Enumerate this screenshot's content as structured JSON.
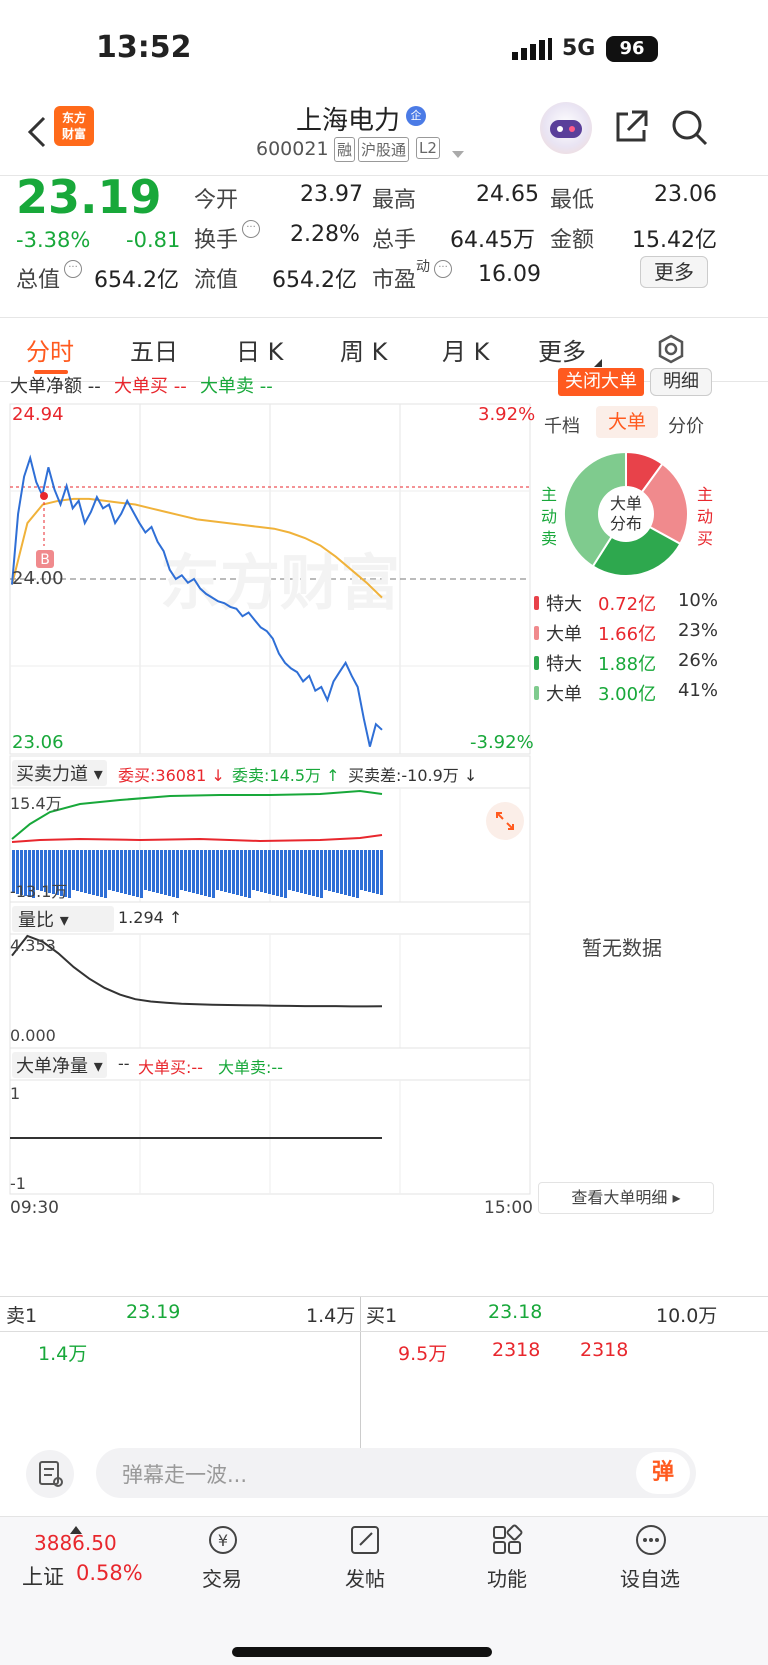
{
  "status": {
    "time": "13:52",
    "network": "5G",
    "battery": "96"
  },
  "nav": {
    "title": "上海电力",
    "title_badge": "企",
    "code": "600021",
    "tags": [
      "融",
      "沪股通",
      "L2"
    ]
  },
  "quote": {
    "price": "23.19",
    "pct": "-3.38%",
    "chg": "-0.81",
    "fields": [
      {
        "label": "今开",
        "value": "23.97",
        "color": "green"
      },
      {
        "label": "最高",
        "value": "24.65",
        "color": "red"
      },
      {
        "label": "最低",
        "value": "23.06",
        "color": "green"
      },
      {
        "label": "换手",
        "value": "2.28%",
        "color": "dark"
      },
      {
        "label": "总手",
        "value": "64.45万",
        "color": "dark"
      },
      {
        "label": "金额",
        "value": "15.42亿",
        "color": "dark"
      },
      {
        "label": "总值",
        "value": "654.2亿",
        "color": "dark"
      },
      {
        "label": "流值",
        "value": "654.2亿",
        "color": "dark"
      },
      {
        "label": "市盈",
        "sup": "动",
        "value": "16.09",
        "color": "dark"
      }
    ],
    "more_btn": "更多"
  },
  "tabs": [
    "分时",
    "五日",
    "日 K",
    "周 K",
    "月 K",
    "更多"
  ],
  "chart_header": {
    "legend_net": "大单净额 --",
    "legend_buy": "大单买 --",
    "legend_sell": "大单卖 --",
    "close_btn": "关闭大单",
    "detail_btn": "明细"
  },
  "price_axis": {
    "top": "24.94",
    "top_pct": "3.92%",
    "mid": "24.00",
    "bottom": "23.06",
    "bottom_pct": "-3.92%",
    "watermark": "东方财富",
    "marker": "B"
  },
  "side_tabs": [
    "千档",
    "大单",
    "分价"
  ],
  "pie": {
    "center1": "大单",
    "center2": "分布",
    "left": [
      "主",
      "动",
      "卖"
    ],
    "right": [
      "主",
      "动",
      "买"
    ],
    "legend": [
      {
        "name": "特大",
        "value": "0.72亿",
        "pct": "10%",
        "color": "#e8424a"
      },
      {
        "name": "大单",
        "value": "1.66亿",
        "pct": "23%",
        "color": "#f08a8d"
      },
      {
        "name": "特大",
        "value": "1.88亿",
        "pct": "26%",
        "color": "#2ea84e"
      },
      {
        "name": "大单",
        "value": "3.00亿",
        "pct": "41%",
        "color": "#7fcb8e"
      }
    ]
  },
  "force": {
    "selector": "买卖力道",
    "buy": "委买:36081 ↓",
    "sell": "委卖:14.5万 ↑",
    "diff": "买卖差:-10.9万 ↓",
    "top": "15.4万",
    "bottom": "-13.1万"
  },
  "ratio": {
    "selector": "量比",
    "value": "1.294 ↑",
    "top": "4.353",
    "bottom": "0.000"
  },
  "netvol": {
    "selector": "大单净量",
    "value": "-- ",
    "buy": "大单买:--",
    "sell": "大单卖:--",
    "top": "1",
    "bottom": "-1"
  },
  "time_axis": {
    "start": "09:30",
    "end": "15:00"
  },
  "no_data": "暂无数据",
  "view_detail": "查看大单明细",
  "depth": {
    "sell_label": "卖1",
    "sell_price": "23.19",
    "sell_vol": "1.4万",
    "buy_label": "买1",
    "buy_price": "23.18",
    "buy_vol": "10.0万",
    "sell_detail": "1.4万",
    "buy_detail": [
      "9.5万",
      "2318",
      "2318"
    ]
  },
  "danmu": {
    "placeholder": "弹幕走一波...",
    "btn": "弹"
  },
  "bottom": {
    "index_value": "3886.50",
    "index_name": "上证",
    "index_pct": "0.58%",
    "items": [
      "交易",
      "发帖",
      "功能",
      "设自选"
    ]
  },
  "chart_data": {
    "type": "line",
    "title": "分时",
    "ylim": [
      23.06,
      24.94
    ],
    "pre_close": 24.0,
    "price": [
      23.97,
      24.35,
      24.55,
      24.65,
      24.52,
      24.45,
      24.6,
      24.48,
      24.4,
      24.5,
      24.38,
      24.42,
      24.3,
      24.36,
      24.44,
      24.38,
      24.4,
      24.3,
      24.35,
      24.42,
      24.36,
      24.3,
      24.25,
      24.28,
      24.2,
      24.15,
      24.05,
      24.0,
      24.02,
      23.98,
      24.0,
      23.95,
      23.92,
      23.9,
      23.88,
      23.87,
      23.85,
      23.84,
      23.8,
      23.82,
      23.78,
      23.74,
      23.72,
      23.68,
      23.6,
      23.55,
      23.52,
      23.5,
      23.45,
      23.48,
      23.4,
      23.42,
      23.35,
      23.45,
      23.5,
      23.55,
      23.48,
      23.42,
      23.25,
      23.1,
      23.22,
      23.19
    ],
    "avg": [
      23.97,
      24.3,
      24.4,
      24.42,
      24.43,
      24.43,
      24.42,
      24.41,
      24.4,
      24.38,
      24.36,
      24.34,
      24.32,
      24.31,
      24.3,
      24.29,
      24.28,
      24.27,
      24.25,
      24.22,
      24.18,
      24.12,
      24.05,
      23.98,
      23.9
    ],
    "pie_pct": [
      10,
      23,
      26,
      41
    ],
    "volume_ratio": [
      3.5,
      4.353,
      4.1,
      3.6,
      3.0,
      2.5,
      2.1,
      1.8,
      1.6,
      1.5,
      1.45,
      1.4,
      1.38,
      1.36,
      1.35,
      1.34,
      1.33,
      1.32,
      1.31,
      1.3,
      1.3,
      1.3,
      1.29,
      1.29,
      1.294
    ]
  }
}
